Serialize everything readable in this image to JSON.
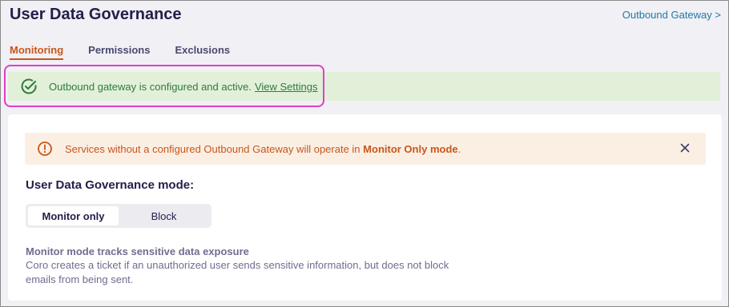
{
  "header": {
    "title": "User Data Governance",
    "gateway_link": "Outbound Gateway >"
  },
  "tabs": [
    {
      "label": "Monitoring",
      "active": true
    },
    {
      "label": "Permissions",
      "active": false
    },
    {
      "label": "Exclusions",
      "active": false
    }
  ],
  "success_banner": {
    "icon": "check-circle-icon",
    "text": "Outbound gateway is configured and active.",
    "link": "View Settings"
  },
  "warning_banner": {
    "icon": "exclamation-circle-icon",
    "text_prefix": "Services without a configured Outbound Gateway will operate in",
    "text_bold": "Monitor Only mode",
    "text_suffix": ".",
    "close_icon": "close-icon"
  },
  "mode": {
    "heading": "User Data Governance mode:",
    "options": [
      "Monitor only",
      "Block"
    ],
    "selected": "Monitor only"
  },
  "description": {
    "title": "Monitor mode tracks sensitive data exposure",
    "body": "Coro creates a ticket if an unauthorized user sends sensitive information, but does not block emails from being sent."
  },
  "colors": {
    "accent_orange": "#c9561a",
    "success_green": "#2e7a3e",
    "link_blue": "#1f7aa8",
    "highlight_magenta": "#e040c4"
  }
}
